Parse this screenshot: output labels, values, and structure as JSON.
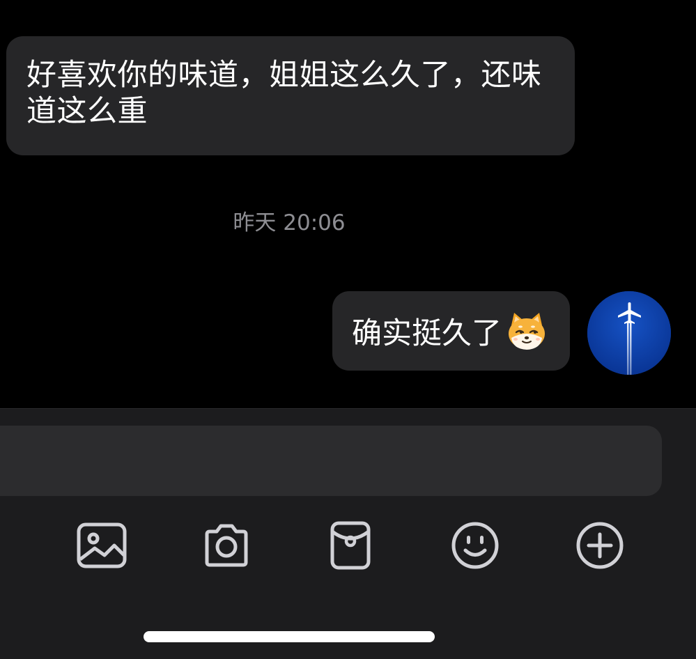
{
  "messages": {
    "incoming": {
      "text": "好喜欢你的味道，姐姐这么久了，还味道这么重"
    },
    "timestamp": "昨天 20:06",
    "outgoing": {
      "text": "确实挺久了",
      "emoji": "shiba-dog-emoji",
      "avatar": "airplane-sky-avatar"
    }
  },
  "input": {
    "value": "",
    "placeholder": ""
  },
  "toolbar": {
    "items": [
      {
        "icon": "image-icon"
      },
      {
        "icon": "camera-icon"
      },
      {
        "icon": "red-packet-icon"
      },
      {
        "icon": "smiley-icon"
      },
      {
        "icon": "plus-circle-icon"
      }
    ]
  },
  "colors": {
    "background": "#000000",
    "bubble": "#262628",
    "panel": "#1c1c1e",
    "input": "#2c2c2e",
    "timestamp": "#8e8e93",
    "icon": "#d1d1d6",
    "avatar_blue": "#0a3ea8"
  }
}
